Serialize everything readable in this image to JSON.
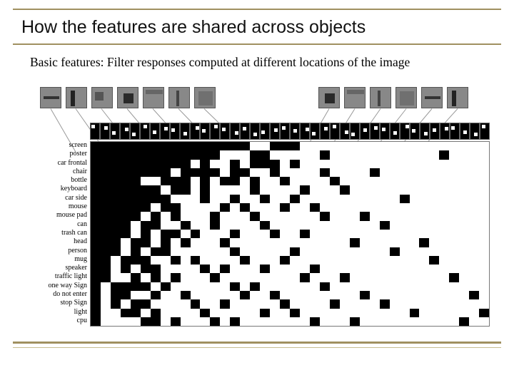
{
  "title": "How the features are shared across objects",
  "subtitle": "Basic features: Filter responses computed at different locations of the image",
  "row_labels": [
    "screen",
    "poster",
    "car frontal",
    "chair",
    "bottle",
    "keyboard",
    "car side",
    "mouse",
    "mouse pad",
    "can",
    "trash can",
    "head",
    "person",
    "mug",
    "speaker",
    "traffic light",
    "one way Sign",
    "do not enter",
    "stop Sign",
    "light",
    "cpu"
  ],
  "thumbs_left_count": 7,
  "thumbs_right_count": 6,
  "matrix_cols": 40,
  "matrix": [
    "1111111111111111001110000000000000000000",
    "1111111111111000110000010000000000010000",
    "1111111111010010111010000000000000000000",
    "1111111101111011001000010000100000000000",
    "1111100111010110100100001000000000000000",
    "1111111011010000100001000100000000000000",
    "1111111100010010010010000000000100000000",
    "1111110110000101000100100000000000000000",
    "1111101010001000100000010001000000000000",
    "1111011001001000010000000000010000000000",
    "1111010110100010001001000000000000000000",
    "1110110101000100000000000010000001000000",
    "1110101100000010000010000000001000000000",
    "1101110010100001000100000000000000100000",
    "1101011000010100010000100000000000000000",
    "1100101010001000000001000100000000001000",
    "1011110100000010100000010000000000000000",
    "1011001001000001001000000001000000000010",
    "1010110000100100000100001000010000000000",
    "1001101000010000010010000000000010000001",
    "1000011010001010000000100010000000000100"
  ],
  "header_dots": [
    [
      2,
      2
    ],
    [
      8,
      3
    ],
    [
      4,
      9
    ],
    [
      10,
      5
    ],
    [
      3,
      11
    ],
    [
      7,
      2
    ],
    [
      5,
      8
    ],
    [
      9,
      4
    ],
    [
      2,
      6
    ],
    [
      6,
      10
    ],
    [
      11,
      3
    ],
    [
      4,
      7
    ],
    [
      8,
      2
    ],
    [
      3,
      5
    ],
    [
      10,
      9
    ],
    [
      5,
      4
    ],
    [
      7,
      11
    ],
    [
      2,
      8
    ],
    [
      9,
      6
    ],
    [
      4,
      3
    ],
    [
      6,
      7
    ],
    [
      11,
      5
    ],
    [
      3,
      10
    ],
    [
      8,
      4
    ],
    [
      5,
      2
    ],
    [
      10,
      8
    ],
    [
      2,
      11
    ],
    [
      7,
      6
    ],
    [
      9,
      3
    ],
    [
      4,
      5
    ],
    [
      6,
      9
    ],
    [
      11,
      2
    ],
    [
      3,
      7
    ],
    [
      8,
      10
    ],
    [
      5,
      6
    ],
    [
      10,
      4
    ],
    [
      2,
      3
    ],
    [
      7,
      8
    ],
    [
      9,
      11
    ],
    [
      4,
      2
    ]
  ]
}
